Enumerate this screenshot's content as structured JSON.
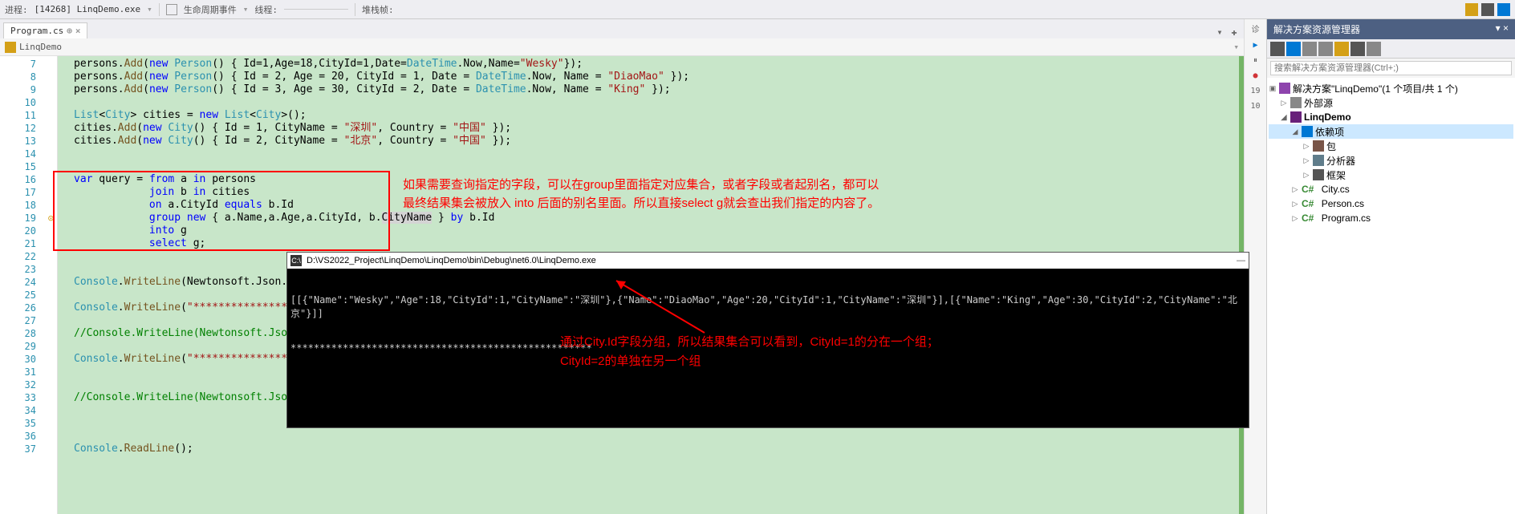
{
  "toolbar": {
    "process_label": "进程:",
    "process_value": "[14268] LinqDemo.exe",
    "lifecycle_label": "生命周期事件",
    "thread_label": "线程:",
    "stackframe_label": "堆栈帧:"
  },
  "tab": {
    "name": "Program.cs"
  },
  "breadcrumb": {
    "namespace": "LinqDemo"
  },
  "code": {
    "line_start": 7,
    "anno1_l1": "如果需要查询指定的字段，可以在group里面指定对应集合，或者字段或者起别名，都可以",
    "anno1_l2": "最终结果集会被放入 into 后面的别名里面。所以直接select g就会查出我们指定的内容了。"
  },
  "console": {
    "title": "D:\\VS2022_Project\\LinqDemo\\LinqDemo\\bin\\Debug\\net6.0\\LinqDemo.exe",
    "line1": "[[{\"Name\":\"Wesky\",\"Age\":18,\"CityId\":1,\"CityName\":\"深圳\"},{\"Name\":\"DiaoMao\",\"Age\":20,\"CityId\":1,\"CityName\":\"深圳\"}],[{\"Name\":\"King\",\"Age\":30,\"CityId\":2,\"CityName\":\"北京\"}]]",
    "line2": "****************************************************",
    "anno_l1": "通过City.Id字段分组，所以结果集合可以看到，CityId=1的分在一个组；",
    "anno_l2": "CityId=2的单独在另一个组"
  },
  "right_sidebar": {
    "diag": "诊",
    "pause_play": "⏸",
    "dot": "●",
    "nums": [
      "19",
      "10"
    ]
  },
  "solution": {
    "title": "解决方案资源管理器",
    "search_placeholder": "搜索解决方案资源管理器(Ctrl+;)",
    "root": "解决方案\"LinqDemo\"(1 个项目/共 1 个)",
    "external": "外部源",
    "project": "LinqDemo",
    "deps": "依赖项",
    "pkg": "包",
    "analyzer": "分析器",
    "framework": "框架",
    "files": [
      "City.cs",
      "Person.cs",
      "Program.cs"
    ]
  }
}
